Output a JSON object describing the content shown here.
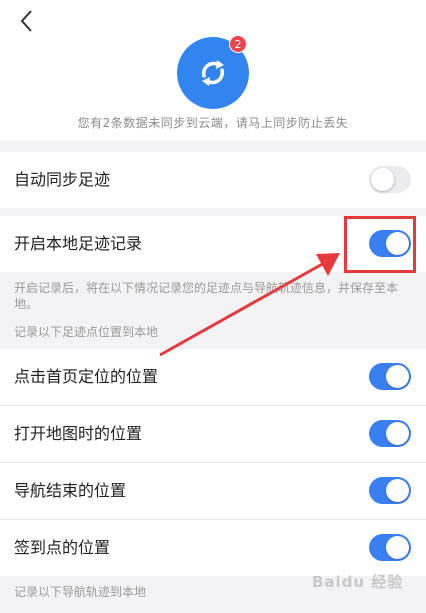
{
  "header": {
    "badge_count": "2",
    "sync_message": "您有2条数据未同步到云端，请马上同步防止丢失"
  },
  "settings": {
    "auto_sync": {
      "label": "自动同步足迹",
      "enabled": false
    },
    "local_record": {
      "label": "开启本地足迹记录",
      "enabled": true
    },
    "local_record_note": "开启记录后，将在以下情况记录您的足迹点与导航轨迹信息，并保存至本地。",
    "points_section_title": "记录以下足迹点位置到本地",
    "point_items": [
      {
        "label": "点击首页定位的位置",
        "enabled": true
      },
      {
        "label": "打开地图时的位置",
        "enabled": true
      },
      {
        "label": "导航结束的位置",
        "enabled": true
      },
      {
        "label": "签到点的位置",
        "enabled": true
      }
    ],
    "tracks_section_title": "记录以下导航轨迹到本地"
  },
  "annotation": {
    "highlight_color": "#e53a3a"
  },
  "colors": {
    "accent": "#3284f0",
    "toggle_on": "#3a7ff0",
    "badge": "#f0424a"
  },
  "watermark": "Baidu 经验"
}
